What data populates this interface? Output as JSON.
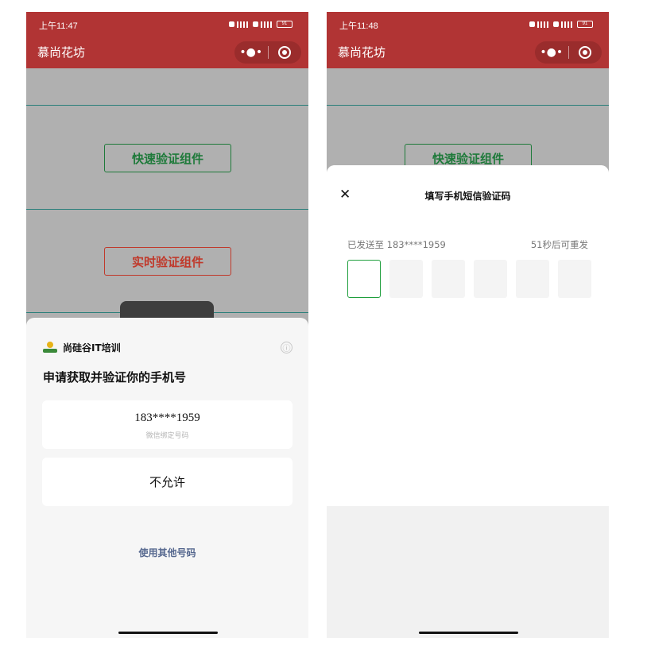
{
  "left_screen": {
    "status_time": "上午11:47",
    "battery": "91",
    "app_title": "慕尚花坊",
    "capsule_more": "•●•",
    "btn_quick": "快速验证组件",
    "btn_realtime": "实时验证组件",
    "sheet": {
      "brand_name": "尚硅谷IT培训",
      "info_icon": "ⓘ",
      "heading": "申请获取并验证你的手机号",
      "phone_number": "183****1959",
      "phone_sub": "微信绑定号码",
      "deny_label": "不允许",
      "other_number_link": "使用其他号码"
    }
  },
  "right_screen": {
    "status_time": "上午11:48",
    "battery": "91",
    "app_title": "慕尚花坊",
    "capsule_more": "•●•",
    "btn_quick": "快速验证组件",
    "sms_sheet": {
      "close": "✕",
      "title": "填写手机短信验证码",
      "sent_to": "已发送至 183****1959",
      "resend_countdown": "51秒后可重发",
      "code_length": 6
    }
  },
  "colors": {
    "topbar": "#b13434",
    "background": "#b0b0b0",
    "accent_green": "#1e7a3a",
    "accent_red": "#c0392b",
    "link_blue": "#56688f"
  }
}
